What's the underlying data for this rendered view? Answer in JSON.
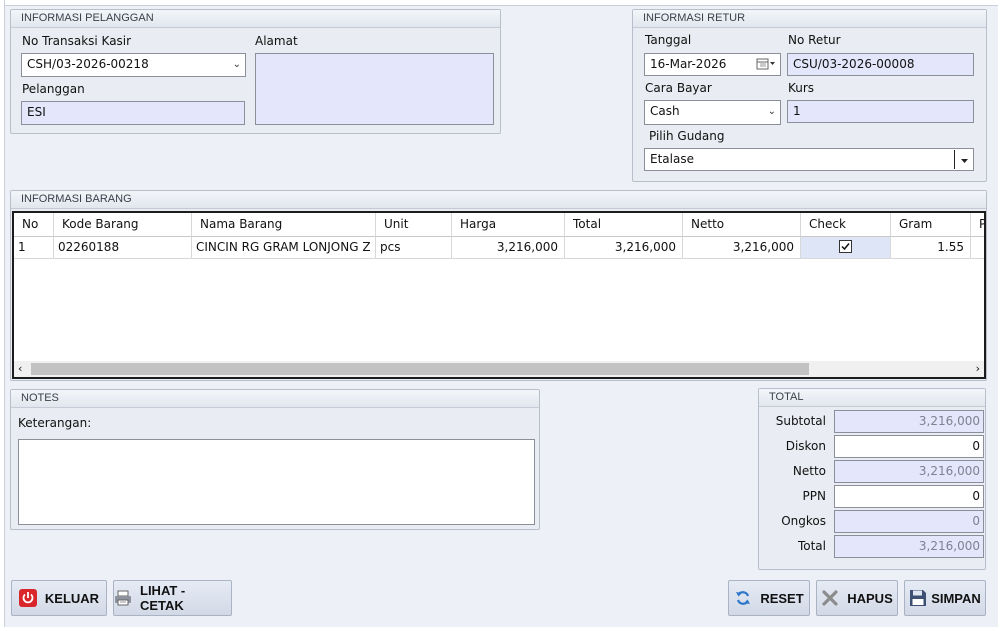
{
  "pelanggan": {
    "title": "INFORMASI PELANGGAN",
    "no_transaksi_label": "No Transaksi Kasir",
    "no_transaksi_value": "CSH/03-2026-00218",
    "alamat_label": "Alamat",
    "alamat_value": "",
    "pelanggan_label": "Pelanggan",
    "pelanggan_value": "ESI"
  },
  "retur": {
    "title": "INFORMASI RETUR",
    "tanggal_label": "Tanggal",
    "tanggal_value": "16-Mar-2026",
    "no_retur_label": "No Retur",
    "no_retur_value": "CSU/03-2026-00008",
    "cara_bayar_label": "Cara Bayar",
    "cara_bayar_value": "Cash",
    "kurs_label": "Kurs",
    "kurs_value": "1",
    "gudang_label": "Pilih Gudang",
    "gudang_value": "Etalase"
  },
  "barang": {
    "title": "INFORMASI BARANG",
    "columns": [
      "No",
      "Kode Barang",
      "Nama Barang",
      "Unit",
      "Harga",
      "Total",
      "Netto",
      "Check",
      "Gram",
      "P"
    ],
    "rows": [
      {
        "no": "1",
        "kode": "02260188",
        "nama": "CINCIN RG GRAM LONJONG Z",
        "unit": "pcs",
        "harga": "3,216,000",
        "total": "3,216,000",
        "netto": "3,216,000",
        "check": true,
        "gram": "1.55"
      }
    ]
  },
  "notes": {
    "title": "NOTES",
    "keterangan_label": "Keterangan:",
    "keterangan_value": ""
  },
  "total": {
    "title": "TOTAL",
    "subtotal_label": "Subtotal",
    "subtotal_value": "3,216,000",
    "diskon_label": "Diskon",
    "diskon_value": "0",
    "netto_label": "Netto",
    "netto_value": "3,216,000",
    "ppn_label": "PPN",
    "ppn_value": "0",
    "ongkos_label": "Ongkos",
    "ongkos_value": "0",
    "total_label": "Total",
    "total_value": "3,216,000"
  },
  "buttons": {
    "keluar": "KELUAR",
    "lihat_cetak": "LIHAT - CETAK",
    "reset": "RESET",
    "hapus": "HAPUS",
    "simpan": "SIMPAN"
  },
  "colors": {
    "readonly_field": "#e4e6fb",
    "power_red": "#d9262b",
    "selected_cell": "#dde5f6"
  },
  "icons": {
    "keluar": "power-icon",
    "lihat_cetak": "printer-icon",
    "reset": "refresh-icon",
    "hapus": "close-x-icon",
    "simpan": "floppy-disk-icon"
  }
}
